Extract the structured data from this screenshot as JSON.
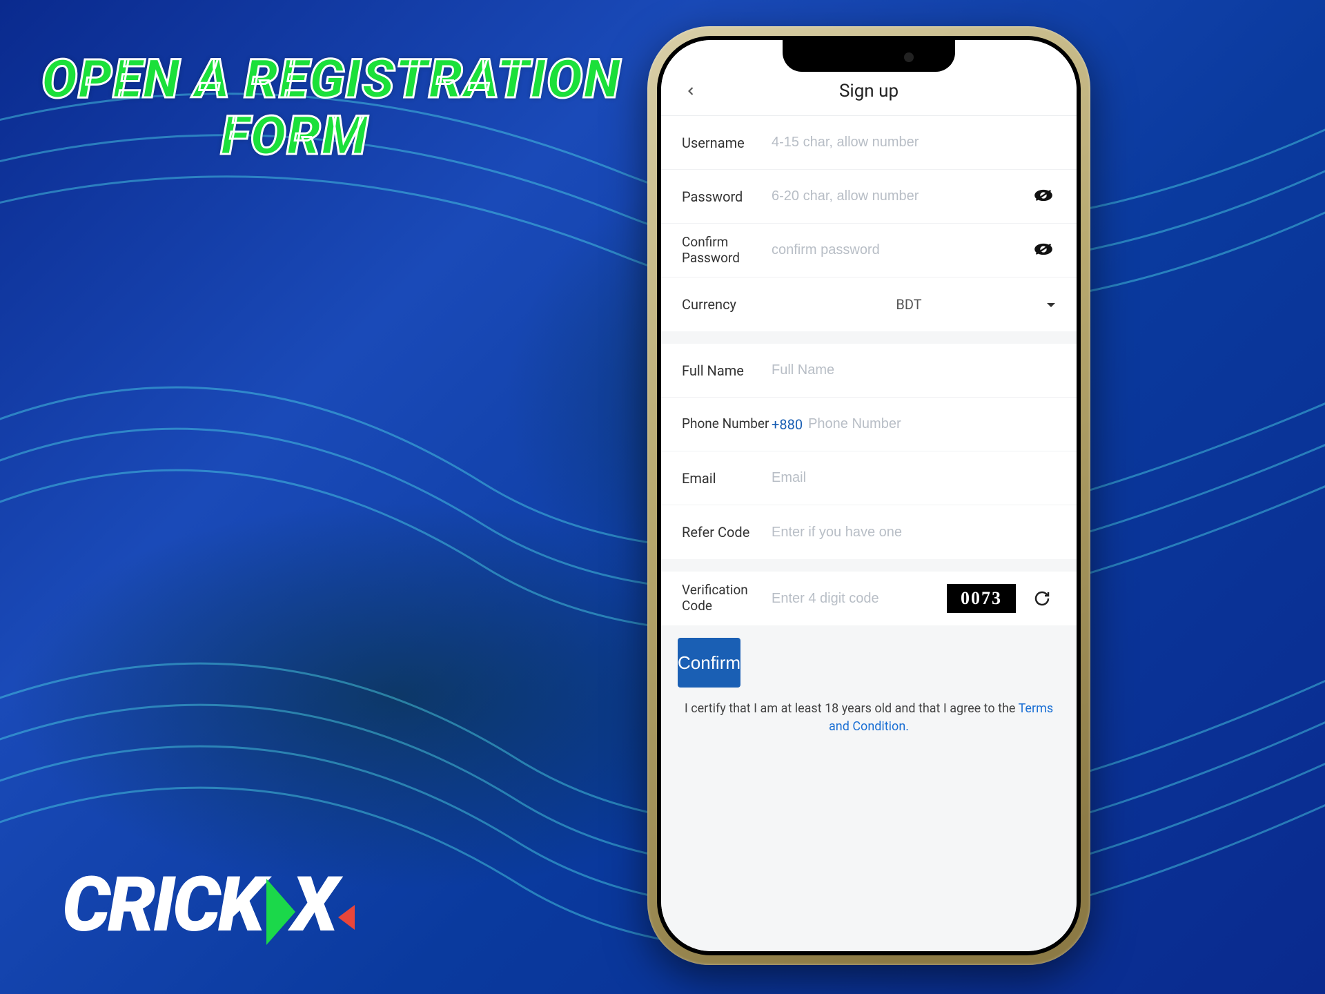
{
  "headline": {
    "line1": "OPEN A REGISTRATION",
    "line2": "FORM"
  },
  "logo": {
    "part1": "CRICK",
    "part2": "X"
  },
  "app": {
    "title": "Sign up",
    "fields": {
      "username": {
        "label": "Username",
        "placeholder": "4-15 char, allow number"
      },
      "password": {
        "label": "Password",
        "placeholder": "6-20 char, allow number"
      },
      "confirm_password": {
        "label": "Confirm Password",
        "placeholder": "confirm password"
      },
      "currency": {
        "label": "Currency",
        "value": "BDT"
      },
      "full_name": {
        "label": "Full Name",
        "placeholder": "Full Name"
      },
      "phone": {
        "label": "Phone Number",
        "prefix": "+880",
        "placeholder": "Phone Number"
      },
      "email": {
        "label": "Email",
        "placeholder": "Email"
      },
      "refer": {
        "label": "Refer Code",
        "placeholder": "Enter if you have one"
      },
      "verify": {
        "label": "Verification Code",
        "placeholder": "Enter 4 digit code",
        "captcha": "0073"
      }
    },
    "confirm_button": "Confirm",
    "certify_text": "I certify that I am at least 18 years old and that I agree to the ",
    "terms_link": "Terms and Condition."
  }
}
